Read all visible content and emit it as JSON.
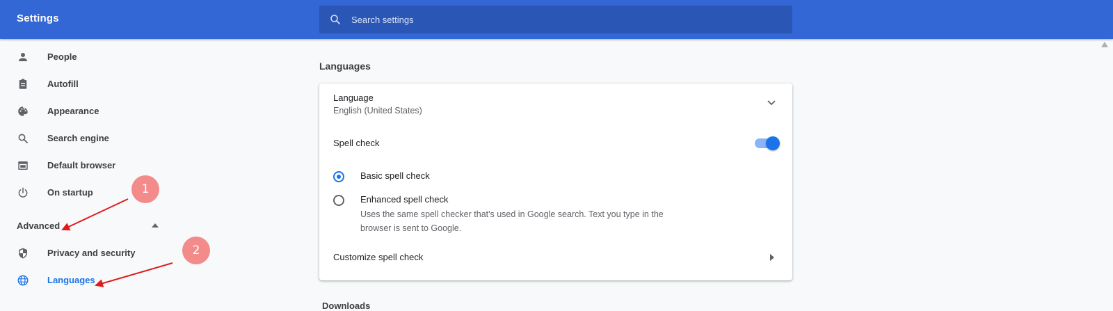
{
  "header": {
    "title": "Settings",
    "search_placeholder": "Search settings"
  },
  "sidebar": {
    "items": [
      {
        "label": "People",
        "icon": "person-icon"
      },
      {
        "label": "Autofill",
        "icon": "clipboard-icon"
      },
      {
        "label": "Appearance",
        "icon": "palette-icon"
      },
      {
        "label": "Search engine",
        "icon": "search-icon"
      },
      {
        "label": "Default browser",
        "icon": "browser-icon"
      },
      {
        "label": "On startup",
        "icon": "power-icon"
      }
    ],
    "advanced_label": "Advanced",
    "advanced_items": [
      {
        "label": "Privacy and security",
        "icon": "shield-icon"
      },
      {
        "label": "Languages",
        "icon": "globe-icon",
        "active": true
      }
    ]
  },
  "main": {
    "section_title": "Languages",
    "language": {
      "title": "Language",
      "value": "English (United States)"
    },
    "spell_check": {
      "label": "Spell check",
      "enabled": true
    },
    "options": [
      {
        "label": "Basic spell check",
        "description": "",
        "selected": true
      },
      {
        "label": "Enhanced spell check",
        "description": "Uses the same spell checker that's used in Google search. Text you type in the browser is sent to Google.",
        "selected": false
      }
    ],
    "customize_label": "Customize spell check",
    "next_section_partial": "Downloads"
  },
  "annotations": {
    "marker_1": "1",
    "marker_2": "2",
    "color": "#f38b8b",
    "arrow_color": "#e01b1b"
  },
  "colors": {
    "header_bg": "#3367d6",
    "search_bg": "#2a56b6",
    "accent": "#1a73e8",
    "page_bg": "#f8f9fa"
  }
}
